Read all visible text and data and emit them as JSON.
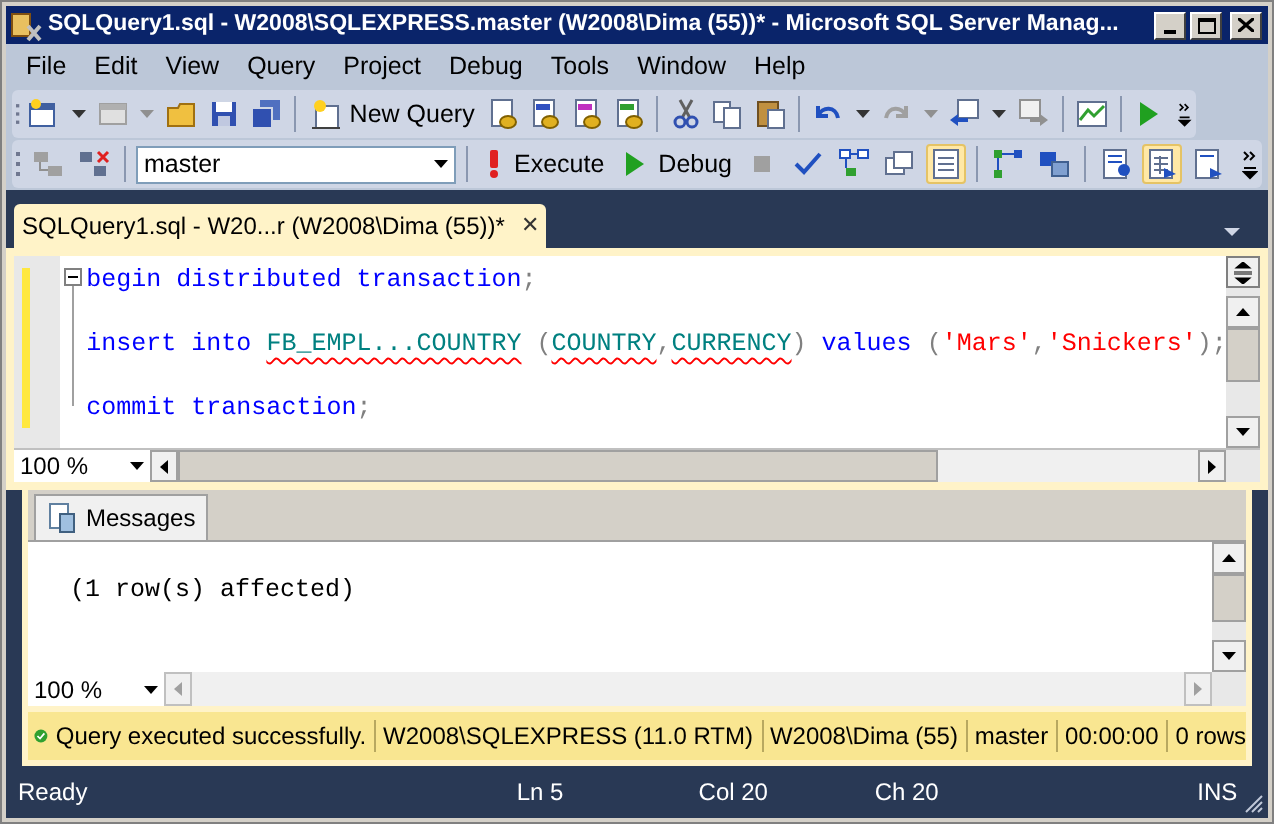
{
  "window": {
    "title": "SQLQuery1.sql - W2008\\SQLEXPRESS.master (W2008\\Dima (55))* - Microsoft SQL Server Manag..."
  },
  "menu": [
    "File",
    "Edit",
    "View",
    "Query",
    "Project",
    "Debug",
    "Tools",
    "Window",
    "Help"
  ],
  "toolbar_1": [
    {
      "kind": "icon"
    },
    {
      "kind": "icon"
    },
    {
      "kind": "icon"
    },
    {
      "kind": "icon"
    },
    {
      "kind": "icon"
    },
    {
      "kind": "icon"
    },
    {
      "kind": "icon"
    },
    {
      "kind": "separator"
    },
    {
      "kind": "button",
      "label": "New Query"
    },
    {
      "kind": "icon"
    },
    {
      "kind": "icon"
    },
    {
      "kind": "icon"
    },
    {
      "kind": "icon"
    },
    {
      "kind": "separator"
    },
    {
      "kind": "icon"
    },
    {
      "kind": "icon"
    },
    {
      "kind": "icon"
    },
    {
      "kind": "separator"
    },
    {
      "kind": "icon"
    },
    {
      "kind": "icon"
    },
    {
      "kind": "icon"
    },
    {
      "kind": "icon"
    },
    {
      "kind": "icon"
    },
    {
      "kind": "icon"
    },
    {
      "kind": "icon"
    },
    {
      "kind": "separator"
    },
    {
      "kind": "icon"
    },
    {
      "kind": "separator"
    },
    {
      "kind": "icon"
    }
  ],
  "toolbar_2": [
    {
      "kind": "icon",
      "selected": false
    },
    {
      "kind": "icon",
      "selected": false
    },
    {
      "kind": "separator"
    },
    {
      "kind": "combo",
      "value": "master"
    },
    {
      "kind": "separator"
    },
    {
      "kind": "button",
      "label": "Execute"
    },
    {
      "kind": "button",
      "label": "Debug"
    },
    {
      "kind": "icon",
      "selected": false
    },
    {
      "kind": "icon",
      "selected": false
    },
    {
      "kind": "icon",
      "selected": false
    },
    {
      "kind": "icon",
      "selected": false
    },
    {
      "kind": "icon",
      "selected": true
    },
    {
      "kind": "separator"
    },
    {
      "kind": "icon",
      "selected": false
    },
    {
      "kind": "icon",
      "selected": false
    },
    {
      "kind": "separator"
    },
    {
      "kind": "icon",
      "selected": false
    },
    {
      "kind": "icon",
      "selected": true
    },
    {
      "kind": "icon",
      "selected": false
    }
  ],
  "document_tab": {
    "title": "SQLQuery1.sql - W20...r (W2008\\Dima (55))*",
    "close": "✕"
  },
  "editor": {
    "lines": [
      {
        "kind": "code",
        "tokens": [
          {
            "kind": "keyword",
            "text": "begin distributed transaction"
          },
          {
            "kind": "plain",
            "text": ";"
          }
        ]
      },
      {
        "kind": "blank"
      },
      {
        "kind": "code",
        "tokens": [
          {
            "kind": "keyword",
            "text": "insert into "
          },
          {
            "kind": "object",
            "text": "FB_EMPL...COUNTRY",
            "error": true
          },
          {
            "kind": "plain",
            "text": " ("
          },
          {
            "kind": "object",
            "text": "COUNTRY",
            "error": true
          },
          {
            "kind": "plain",
            "text": ","
          },
          {
            "kind": "object",
            "text": "CURRENCY",
            "error": true
          },
          {
            "kind": "plain",
            "text": ") "
          },
          {
            "kind": "keyword",
            "text": "values"
          },
          {
            "kind": "plain",
            "text": " ("
          },
          {
            "kind": "string",
            "text": "'Mars'"
          },
          {
            "kind": "plain",
            "text": ","
          },
          {
            "kind": "string",
            "text": "'Snickers'"
          },
          {
            "kind": "plain",
            "text": ");"
          }
        ]
      },
      {
        "kind": "blank"
      },
      {
        "kind": "code",
        "tokens": [
          {
            "kind": "keyword",
            "text": "commit transaction"
          },
          {
            "kind": "plain",
            "text": ";"
          }
        ]
      }
    ],
    "zoom": "100 %"
  },
  "results": {
    "tab": "Messages",
    "messages": [
      "(1 row(s) affected)"
    ],
    "zoom": "100 %"
  },
  "query_status": [
    "Query executed successfully.",
    "W2008\\SQLEXPRESS (11.0 RTM)",
    "W2008\\Dima (55)",
    "master",
    "00:00:00",
    "0 rows"
  ],
  "status_bar": [
    "Ready",
    "Ln 5",
    "Col 20",
    "Ch 20",
    "INS"
  ]
}
